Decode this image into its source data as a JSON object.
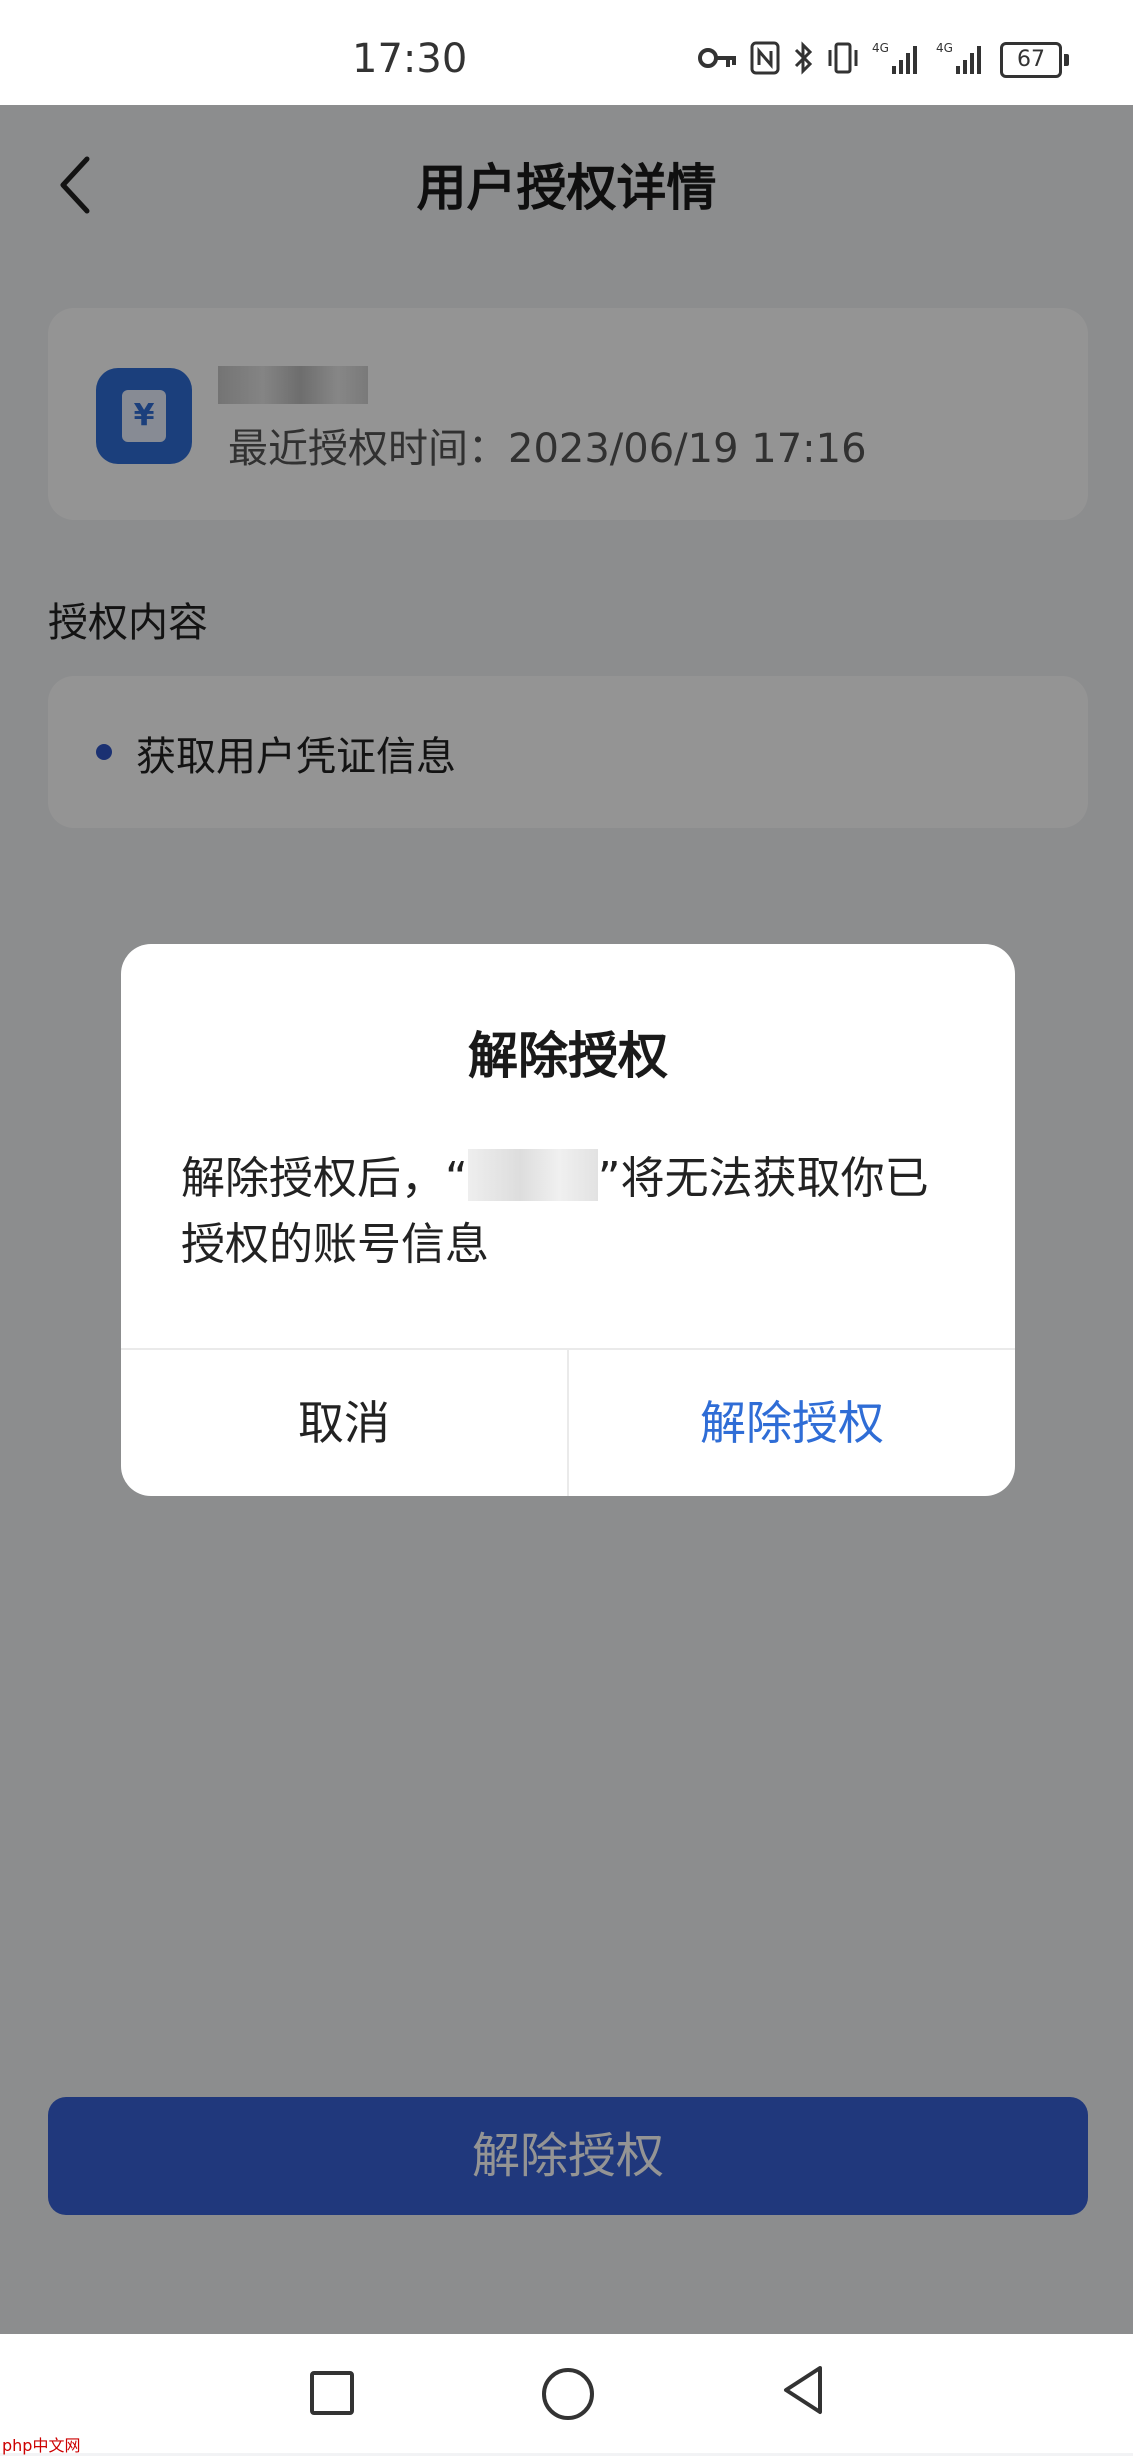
{
  "status_bar": {
    "time": "17:30",
    "icons": [
      "key-icon",
      "nfc-icon",
      "bluetooth-icon",
      "vibrate-icon",
      "signal-4g-icon",
      "signal-4g-icon"
    ],
    "battery": "67"
  },
  "header": {
    "title": "用户授权详情"
  },
  "app_card": {
    "icon_glyph": "¥",
    "last_auth_time": "最近授权时间：2023/06/19 17:16"
  },
  "content_section": {
    "label": "授权内容",
    "items": [
      "获取用户凭证信息"
    ]
  },
  "main_button": {
    "label": "解除授权"
  },
  "dialog": {
    "title": "解除授权",
    "message_before": "解除授权后，“",
    "message_after": "”将无法获取你已授权的账号信息",
    "cancel_label": "取消",
    "confirm_label": "解除授权"
  },
  "colors": {
    "accent": "#2f6dd6",
    "button_blue": "#3761d6"
  },
  "watermark": "php中文网"
}
